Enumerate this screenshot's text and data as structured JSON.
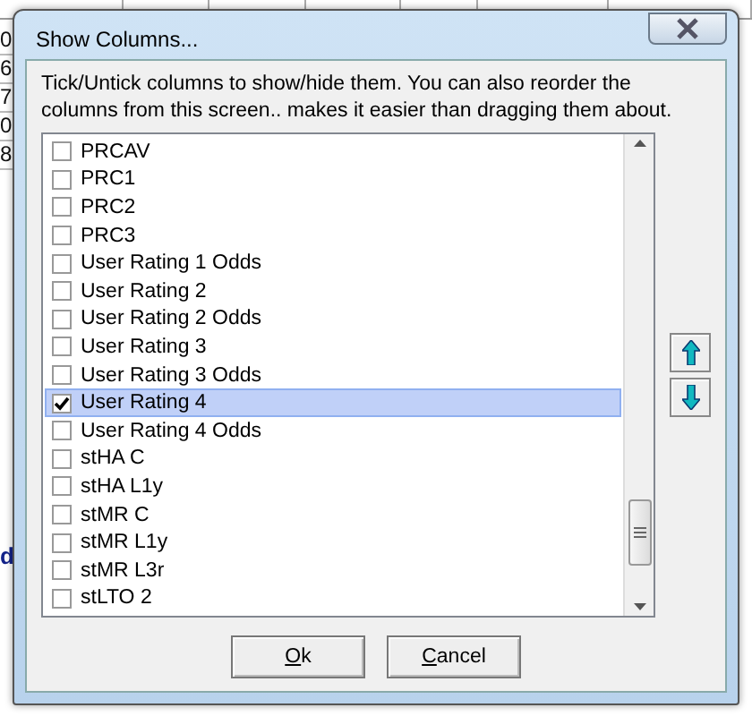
{
  "background_sheet": {
    "left_cells": [
      "0",
      "6",
      "7",
      "0",
      "8"
    ],
    "lower_left_cells": [
      {
        "text": "d",
        "kind": "bold"
      }
    ]
  },
  "dialog": {
    "title": "Show Columns...",
    "instructions": "Tick/Untick columns to show/hide them. You can also reorder the columns from this screen.. makes it easier than dragging them about.",
    "columns": [
      {
        "label": "PRCAV",
        "checked": false,
        "selected": false
      },
      {
        "label": "PRC1",
        "checked": false,
        "selected": false
      },
      {
        "label": "PRC2",
        "checked": false,
        "selected": false
      },
      {
        "label": "PRC3",
        "checked": false,
        "selected": false
      },
      {
        "label": "User Rating 1 Odds",
        "checked": false,
        "selected": false
      },
      {
        "label": "User Rating 2",
        "checked": false,
        "selected": false
      },
      {
        "label": "User Rating 2 Odds",
        "checked": false,
        "selected": false
      },
      {
        "label": "User Rating 3",
        "checked": false,
        "selected": false
      },
      {
        "label": "User Rating 3 Odds",
        "checked": false,
        "selected": false
      },
      {
        "label": "User Rating 4",
        "checked": true,
        "selected": true
      },
      {
        "label": "User Rating 4 Odds",
        "checked": false,
        "selected": false
      },
      {
        "label": "stHA C",
        "checked": false,
        "selected": false
      },
      {
        "label": "stHA L1y",
        "checked": false,
        "selected": false
      },
      {
        "label": "stMR C",
        "checked": false,
        "selected": false
      },
      {
        "label": "stMR L1y",
        "checked": false,
        "selected": false
      },
      {
        "label": "stMR L3r",
        "checked": false,
        "selected": false
      },
      {
        "label": "stLTO 2",
        "checked": false,
        "selected": false
      }
    ],
    "buttons": [
      {
        "label": "Ok"
      },
      {
        "label": "Cancel"
      }
    ]
  }
}
